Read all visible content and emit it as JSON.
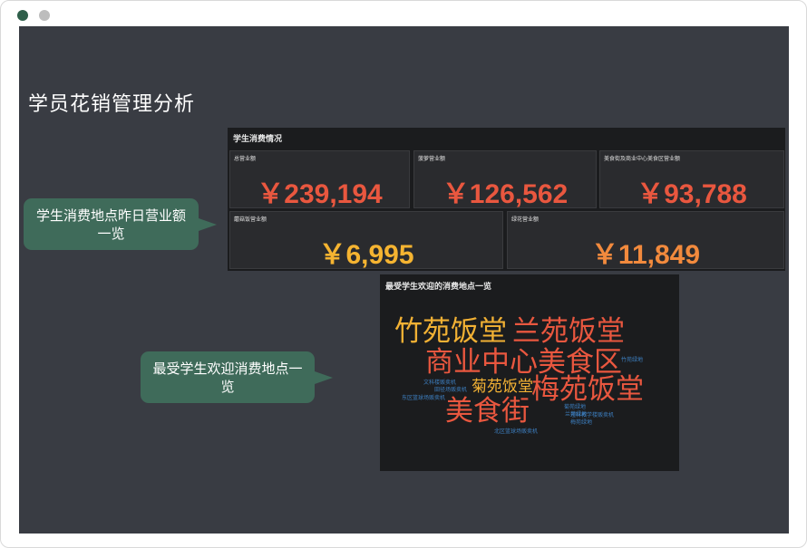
{
  "page": {
    "title": "学员花销管理分析"
  },
  "callouts": [
    {
      "text": "学生消费地点昨日营业额一览"
    },
    {
      "text": "最受学生欢迎消费地点一览"
    }
  ],
  "kpi_panel": {
    "title": "学生消费情况",
    "items": [
      {
        "label": "总营业额",
        "value": "￥239,194",
        "color": "#e9573f"
      },
      {
        "label": "菠萝营业额",
        "value": "￥126,562",
        "color": "#e9573f"
      },
      {
        "label": "美食街及商业中心美食区营业额",
        "value": "￥93,788",
        "color": "#e9573f"
      },
      {
        "label": "蘑菇饭营业额",
        "value": "￥6,995",
        "color": "#f5b431"
      },
      {
        "label": "绿花营业额",
        "value": "￥11,849",
        "color": "#f28a3d"
      }
    ]
  },
  "cloud_panel": {
    "title": "最受学生欢迎的消费地点一览",
    "words": [
      {
        "text": "竹苑饭堂",
        "color": "#f2b134",
        "size": "big"
      },
      {
        "text": "兰苑饭堂",
        "color": "#e9573f",
        "size": "big"
      },
      {
        "text": "商业中心美食区",
        "color": "#e9573f",
        "size": "big"
      },
      {
        "text": "菊苑饭堂",
        "color": "#f2b134",
        "size": "mid"
      },
      {
        "text": "梅苑饭堂",
        "color": "#e9573f",
        "size": "big"
      },
      {
        "text": "美食街",
        "color": "#e9573f",
        "size": "big"
      },
      {
        "text": "竹苑绿地",
        "color": "#3d7fc0",
        "size": "small"
      },
      {
        "text": "文科楼贩卖机",
        "color": "#3d7fc0",
        "size": "small"
      },
      {
        "text": "田径场贩卖机",
        "color": "#3d7fc0",
        "size": "small"
      },
      {
        "text": "东区篮球场贩卖机",
        "color": "#3d7fc0",
        "size": "small"
      },
      {
        "text": "菊苑绿地",
        "color": "#3d7fc0",
        "size": "small"
      },
      {
        "text": "兰苑绿地",
        "color": "#3d7fc0",
        "size": "small"
      },
      {
        "text": "理科教学楼贩卖机",
        "color": "#3d7fc0",
        "size": "small"
      },
      {
        "text": "梅苑绿地",
        "color": "#3d7fc0",
        "size": "small"
      },
      {
        "text": "北区篮球场贩卖机",
        "color": "#3d7fc0",
        "size": "small"
      }
    ]
  }
}
